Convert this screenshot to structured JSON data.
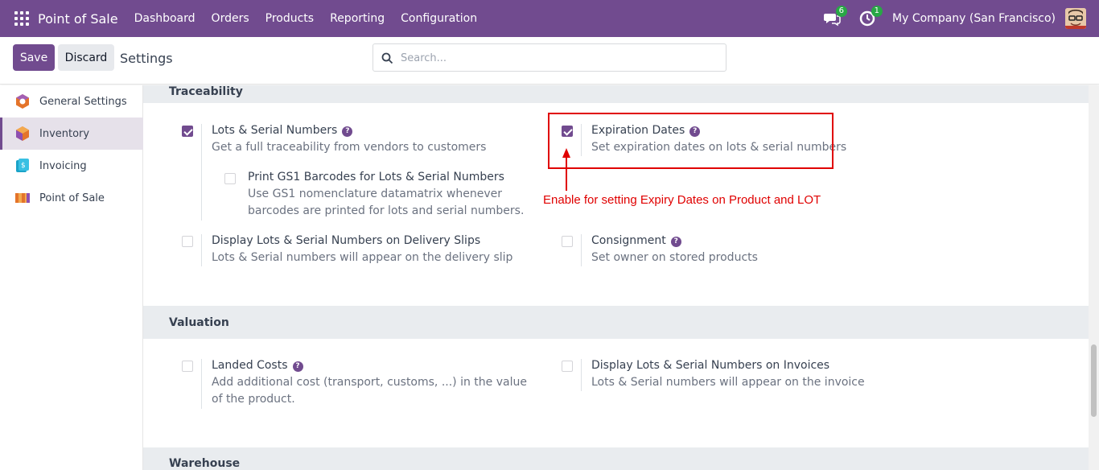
{
  "topbar": {
    "app_title": "Point of Sale",
    "menu": [
      "Dashboard",
      "Orders",
      "Products",
      "Reporting",
      "Configuration"
    ],
    "messages_count": "6",
    "activity_count": "1",
    "company": "My Company (San Francisco)"
  },
  "control_panel": {
    "save_label": "Save",
    "discard_label": "Discard",
    "breadcrumb": "Settings",
    "search_placeholder": "Search..."
  },
  "sidebar": {
    "items": [
      {
        "label": "General Settings",
        "icon": "general-settings-icon",
        "active": false
      },
      {
        "label": "Inventory",
        "icon": "inventory-icon",
        "active": true
      },
      {
        "label": "Invoicing",
        "icon": "invoicing-icon",
        "active": false
      },
      {
        "label": "Point of Sale",
        "icon": "point-of-sale-icon",
        "active": false
      }
    ]
  },
  "sections": {
    "traceability": "Traceability",
    "valuation": "Valuation",
    "warehouse": "Warehouse"
  },
  "settings": {
    "lots_serial": {
      "title": "Lots & Serial Numbers",
      "desc": "Get a full traceability from vendors to customers",
      "checked": true
    },
    "gs1": {
      "title": "Print GS1 Barcodes for Lots & Serial Numbers",
      "desc": "Use GS1 nomenclature datamatrix whenever barcodes are printed for lots and serial numbers.",
      "checked": false
    },
    "expiration": {
      "title": "Expiration Dates",
      "desc": "Set expiration dates on lots & serial numbers",
      "checked": true
    },
    "delivery_slips": {
      "title": "Display Lots & Serial Numbers on Delivery Slips",
      "desc": "Lots & Serial numbers will appear on the delivery slip",
      "checked": false
    },
    "consignment": {
      "title": "Consignment",
      "desc": "Set owner on stored products",
      "checked": false
    },
    "landed_costs": {
      "title": "Landed Costs",
      "desc": "Add additional cost (transport, customs, ...) in the value of the product.",
      "checked": false
    },
    "invoices_lots": {
      "title": "Display Lots & Serial Numbers on Invoices",
      "desc": "Lots & Serial numbers will appear on the invoice",
      "checked": false
    }
  },
  "annotation": {
    "text": "Enable for setting Expiry Dates on Product and LOT",
    "color": "#e00000"
  },
  "colors": {
    "brand": "#714b8f"
  }
}
